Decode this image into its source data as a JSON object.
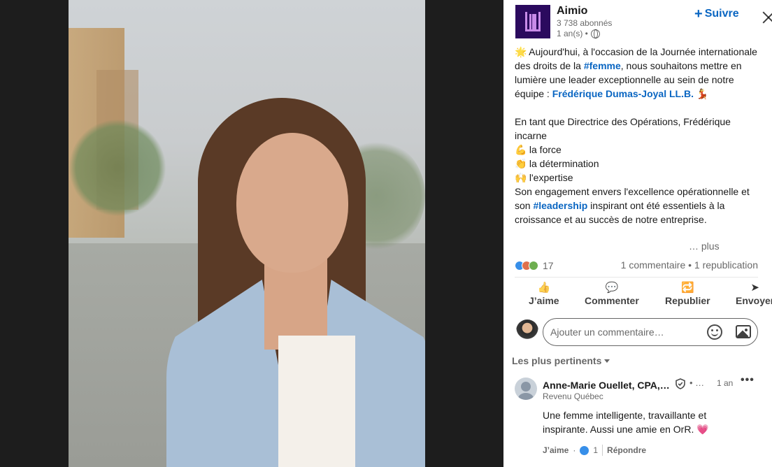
{
  "post": {
    "company": "Aimio",
    "followers": "3 738 abonnés",
    "time": "1 an(s) •",
    "follow_label": "Suivre",
    "text": {
      "p1_a": "Aujourd'hui, à l'occasion de la Journée internationale des droits de la ",
      "p1_hashtag": "#femme",
      "p1_b": ", nous souhaitons mettre en lumière une leader exceptionnelle au sein de notre équipe : ",
      "p1_mention": "Frédérique Dumas-Joyal LL.B.",
      "p2": "En tant que Directrice des Opérations, Frédérique incarne",
      "item1": "la force",
      "item2": "la détermination",
      "item3": "l'expertise",
      "p3_a": "Son engagement envers l'excellence opérationnelle et son ",
      "p3_hashtag": "#leadership",
      "p3_b": " inspirant ont été essentiels à la croissance et au succès de notre entreprise.",
      "more": "… plus"
    },
    "emojis": {
      "star": "🌟",
      "dancer": "💃",
      "muscle": "💪",
      "clap": "👏",
      "raised": "🙌",
      "heart": "💗"
    },
    "reaction_count": "17",
    "counts_right": "1 commentaire • 1 republication"
  },
  "actions": {
    "like": "J’aime",
    "comment": "Commenter",
    "repost": "Republier",
    "send": "Envoyer"
  },
  "comment_box": {
    "placeholder": "Ajouter un commentaire…"
  },
  "sort_label": "Les plus pertinents",
  "comment": {
    "name": "Anne-Marie Ouellet, CPA,…",
    "dots": "• …",
    "time": "1 an",
    "subtitle": "Revenu Québec",
    "text": "Une femme intelligente, travaillante et inspirante. Aussi une amie en OrR.",
    "like_label": "J’aime",
    "like_count": "1",
    "reply_label": "Répondre"
  },
  "colors": {
    "accent": "#0a66c2",
    "logo_bg": "#2b0a5e"
  }
}
